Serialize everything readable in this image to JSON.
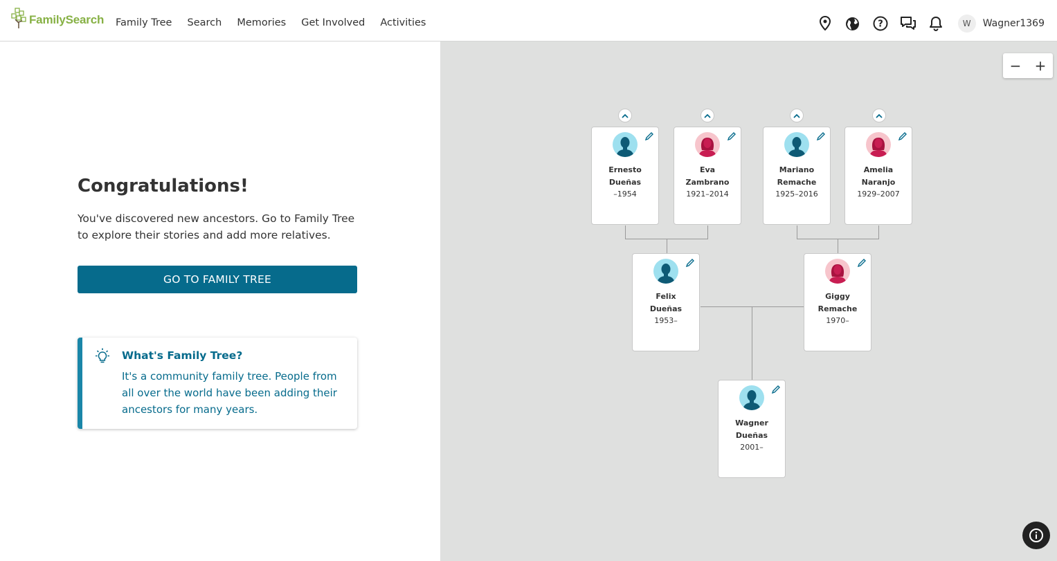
{
  "brand": {
    "name": "FamilySearch",
    "color": "#87b145"
  },
  "nav": [
    "Family Tree",
    "Search",
    "Memories",
    "Get Involved",
    "Activities"
  ],
  "header_icons": [
    "location-pin-icon",
    "globe-icon",
    "help-icon",
    "messages-icon",
    "bell-icon"
  ],
  "user": {
    "initial": "W",
    "name": "Wagner1369"
  },
  "left": {
    "title": "Congratulations!",
    "description": "You've discovered new ancestors. Go to Family Tree to explore their stories and add more relatives.",
    "cta_label": "GO TO FAMILY TREE",
    "tip": {
      "title": "What's Family Tree?",
      "body": "It's a community family tree. People from all over the world have been adding their ancestors for many years."
    }
  },
  "zoom": {
    "out": "−",
    "in": "+"
  },
  "tree": {
    "grandparents": [
      {
        "first": "Ernesto",
        "last": "Dueñas",
        "dates": "–1954",
        "gender": "male"
      },
      {
        "first": "Eva",
        "last": "Zambrano",
        "dates": "1921–2014",
        "gender": "female"
      },
      {
        "first": "Mariano",
        "last": "Remache",
        "dates": "1925–2016",
        "gender": "male"
      },
      {
        "first": "Amelia",
        "last": "Naranjo",
        "dates": "1929–2007",
        "gender": "female"
      }
    ],
    "parents": [
      {
        "first": "Felix",
        "last": "Dueñas",
        "dates": "1953–",
        "gender": "male"
      },
      {
        "first": "Giggy",
        "last": "Remache",
        "dates": "1970–",
        "gender": "female"
      }
    ],
    "self": {
      "first": "Wagner",
      "last": "Dueñas",
      "dates": "2001–",
      "gender": "male"
    }
  },
  "colors": {
    "primary": "#066b8c",
    "tip_border": "#1a86a8",
    "canvas_bg": "#dfe0df"
  }
}
